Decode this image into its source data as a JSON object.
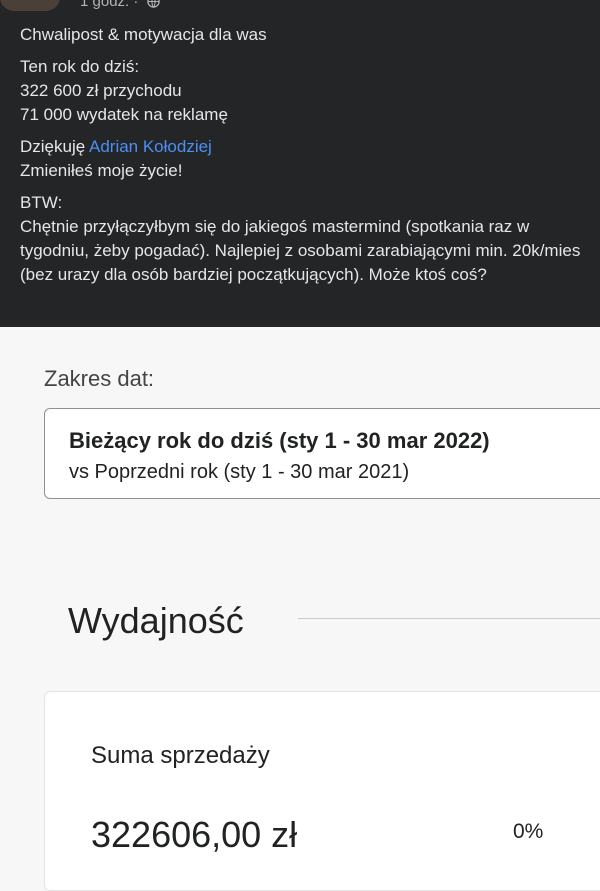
{
  "post": {
    "time": "1 godz. ·",
    "globe_icon": "globe-icon",
    "title": "Chwalipost & motywacja dla was",
    "stats": {
      "heading": "Ten rok do dziś:",
      "revenue": "322 600 zł przychodu",
      "ads": "71 000 wydatek na reklamę"
    },
    "thanks": {
      "prefix": "Dziękuję ",
      "mention": "Adrian Kołodziej",
      "line2": "Zmieniłeś moje życie!"
    },
    "btw": {
      "heading": "BTW:",
      "body": "Chętnie przyłączyłbym się do jakiegoś mastermind (spotkania raz w tygodniu, żeby pogadać). Najlepiej z osobami zarabiającymi min. 20k/mies (bez urazy dla osób bardziej początkujących). Może ktoś coś?"
    },
    "colors": {
      "background": "#242526",
      "text": "#e4e6eb",
      "link": "#4b8ff4"
    }
  },
  "analytics": {
    "date_range_label": "Zakres dat:",
    "date_range": {
      "current": "Bieżący rok do dziś (sty 1 - 30 mar 2022)",
      "comparison": "vs Poprzedni rok (sty 1 - 30 mar 2021)"
    },
    "section_title": "Wydajność",
    "sales_card": {
      "title": "Suma sprzedaży",
      "value": "322606,00 zł",
      "change": "0%"
    }
  }
}
